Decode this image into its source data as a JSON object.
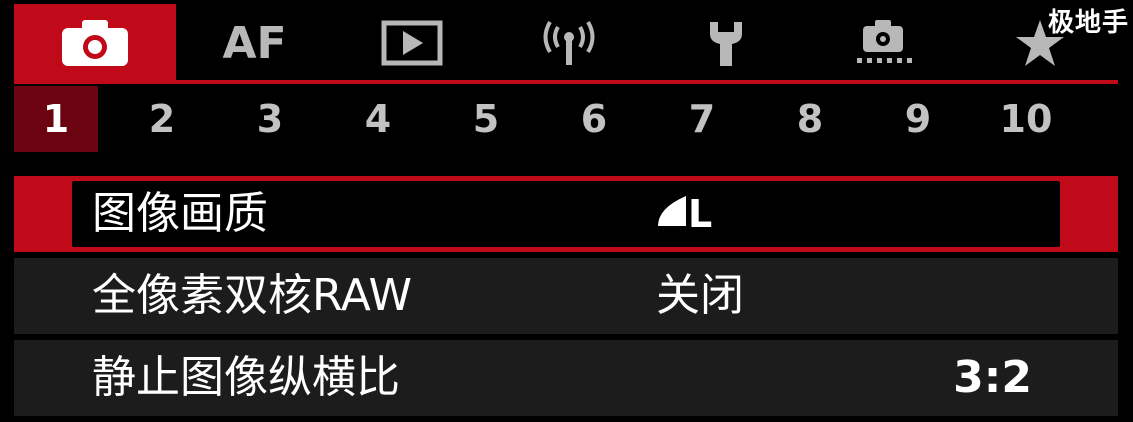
{
  "watermark": "极地手",
  "tabs": [
    {
      "name": "camera-icon",
      "label": ""
    },
    {
      "name": "af-tab",
      "label": "AF"
    },
    {
      "name": "playback-icon",
      "label": ""
    },
    {
      "name": "wireless-icon",
      "label": ""
    },
    {
      "name": "wrench-icon",
      "label": ""
    },
    {
      "name": "custom-camera-icon",
      "label": ""
    },
    {
      "name": "star-icon",
      "label": ""
    }
  ],
  "pages": [
    "1",
    "2",
    "3",
    "4",
    "5",
    "6",
    "7",
    "8",
    "9",
    "10"
  ],
  "active_page": "1",
  "menu": [
    {
      "label": "图像画质",
      "value": "L",
      "value_icon": "quality-fine-icon",
      "selected": true
    },
    {
      "label": "全像素双核RAW",
      "value": "关闭",
      "selected": false
    },
    {
      "label": "静止图像纵横比",
      "value": "3:2",
      "selected": false
    }
  ],
  "colors": {
    "accent": "#c00a1a",
    "active_page_bg": "#6b0410",
    "row_bg": "#1c1c1c"
  }
}
